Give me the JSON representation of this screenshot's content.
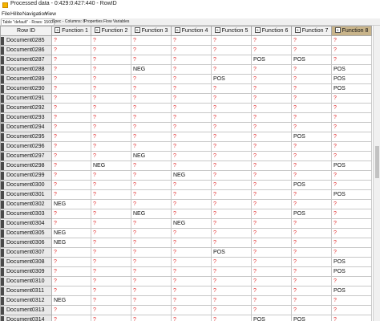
{
  "window": {
    "title": "Processed data - 0:429:0:427:440 - RowID"
  },
  "menu": [
    "File",
    "Hilite",
    "Navigation",
    "View"
  ],
  "tabs": [
    "Table \"default\" - Rows: 1500",
    "Spec - Columns: 8",
    "Properties",
    "Flow Variables"
  ],
  "table": {
    "columns": [
      "Row ID",
      "Function 1",
      "Function 2",
      "Function 3",
      "Function 4",
      "Function 5",
      "Function 6",
      "Function 7",
      "Function 8"
    ],
    "column_type_badge": "S",
    "rows": [
      [
        "Document0285",
        "?",
        "?",
        "?",
        "?",
        "?",
        "?",
        "?",
        "?"
      ],
      [
        "Document0286",
        "?",
        "?",
        "?",
        "?",
        "?",
        "?",
        "?",
        "?"
      ],
      [
        "Document0287",
        "?",
        "?",
        "?",
        "?",
        "?",
        "POS",
        "POS",
        "?"
      ],
      [
        "Document0288",
        "?",
        "?",
        "NEG",
        "?",
        "?",
        "?",
        "?",
        "POS"
      ],
      [
        "Document0289",
        "?",
        "?",
        "?",
        "?",
        "POS",
        "?",
        "?",
        "POS"
      ],
      [
        "Document0290",
        "?",
        "?",
        "?",
        "?",
        "?",
        "?",
        "?",
        "POS"
      ],
      [
        "Document0291",
        "?",
        "?",
        "?",
        "?",
        "?",
        "?",
        "?",
        "?"
      ],
      [
        "Document0292",
        "?",
        "?",
        "?",
        "?",
        "?",
        "?",
        "?",
        "?"
      ],
      [
        "Document0293",
        "?",
        "?",
        "?",
        "?",
        "?",
        "?",
        "?",
        "?"
      ],
      [
        "Document0294",
        "?",
        "?",
        "?",
        "?",
        "?",
        "?",
        "?",
        "?"
      ],
      [
        "Document0295",
        "?",
        "?",
        "?",
        "?",
        "?",
        "?",
        "POS",
        "?"
      ],
      [
        "Document0296",
        "?",
        "?",
        "?",
        "?",
        "?",
        "?",
        "?",
        "?"
      ],
      [
        "Document0297",
        "?",
        "?",
        "NEG",
        "?",
        "?",
        "?",
        "?",
        "?"
      ],
      [
        "Document0298",
        "?",
        "NEG",
        "?",
        "?",
        "?",
        "?",
        "?",
        "POS"
      ],
      [
        "Document0299",
        "?",
        "?",
        "?",
        "NEG",
        "?",
        "?",
        "?",
        "?"
      ],
      [
        "Document0300",
        "?",
        "?",
        "?",
        "?",
        "?",
        "?",
        "POS",
        "?"
      ],
      [
        "Document0301",
        "?",
        "?",
        "?",
        "?",
        "?",
        "?",
        "?",
        "POS"
      ],
      [
        "Document0302",
        "NEG",
        "?",
        "?",
        "?",
        "?",
        "?",
        "?",
        "?"
      ],
      [
        "Document0303",
        "?",
        "?",
        "NEG",
        "?",
        "?",
        "?",
        "POS",
        "?"
      ],
      [
        "Document0304",
        "?",
        "?",
        "?",
        "NEG",
        "?",
        "?",
        "?",
        "?"
      ],
      [
        "Document0305",
        "NEG",
        "?",
        "?",
        "?",
        "?",
        "?",
        "?",
        "?"
      ],
      [
        "Document0306",
        "NEG",
        "?",
        "?",
        "?",
        "?",
        "?",
        "?",
        "?"
      ],
      [
        "Document0307",
        "?",
        "?",
        "?",
        "?",
        "POS",
        "?",
        "?",
        "?"
      ],
      [
        "Document0308",
        "?",
        "?",
        "?",
        "?",
        "?",
        "?",
        "?",
        "POS"
      ],
      [
        "Document0309",
        "?",
        "?",
        "?",
        "?",
        "?",
        "?",
        "?",
        "POS"
      ],
      [
        "Document0310",
        "?",
        "?",
        "?",
        "?",
        "?",
        "?",
        "?",
        "?"
      ],
      [
        "Document0311",
        "?",
        "?",
        "?",
        "?",
        "?",
        "?",
        "?",
        "POS"
      ],
      [
        "Document0312",
        "NEG",
        "?",
        "?",
        "?",
        "?",
        "?",
        "?",
        "?"
      ],
      [
        "Document0313",
        "?",
        "?",
        "?",
        "?",
        "?",
        "?",
        "?",
        "?"
      ],
      [
        "Document0314",
        "?",
        "?",
        "?",
        "?",
        "?",
        "POS",
        "POS",
        "?"
      ],
      [
        "Document0315",
        "?",
        "?",
        "?",
        "?",
        "?",
        "POS",
        "POS",
        "POS"
      ]
    ]
  },
  "colors": {
    "missing_value": "#e03030",
    "sorted_header": "#c8b48a",
    "row_marker": "#4a4a4a"
  }
}
